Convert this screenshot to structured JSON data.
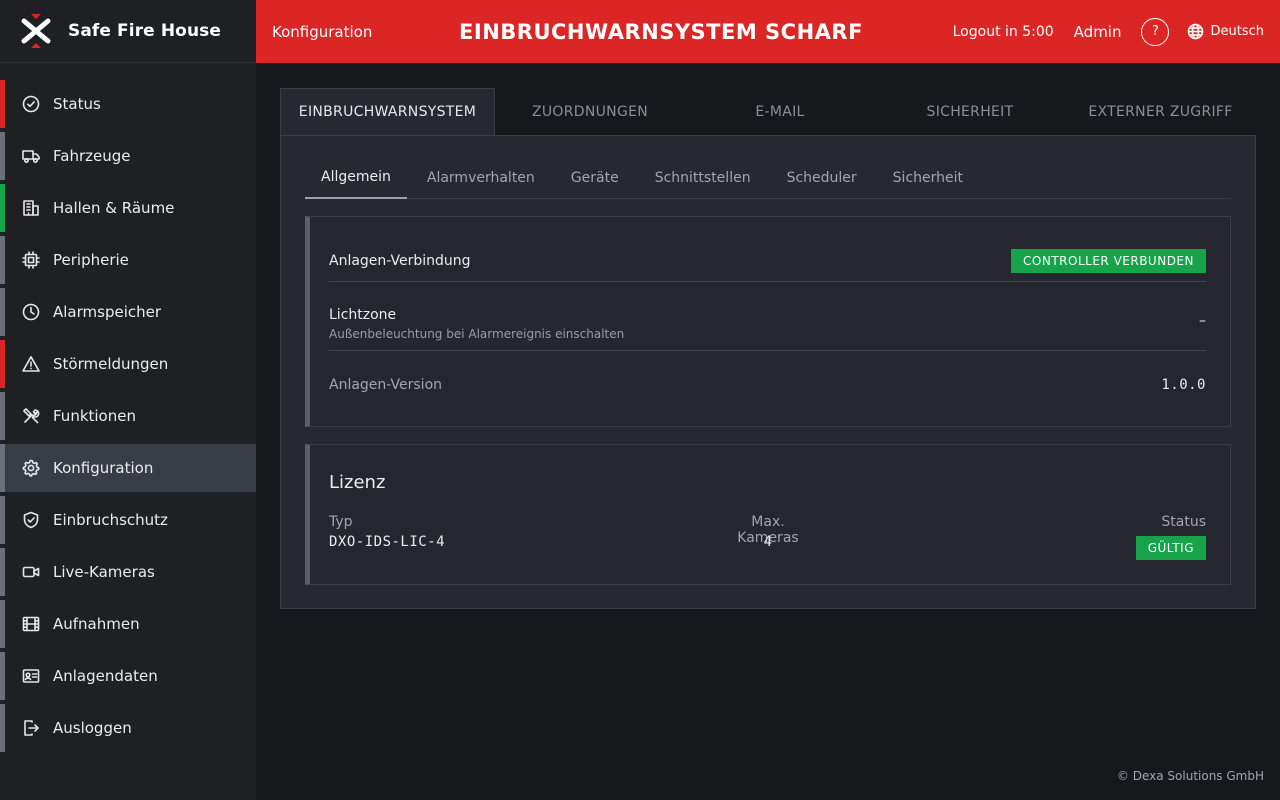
{
  "brand": {
    "name": "Safe Fire House"
  },
  "header": {
    "section": "Konfiguration",
    "title": "EINBRUCHWARNSYSTEM SCHARF",
    "logout": "Logout in 5:00",
    "user": "Admin",
    "help": "?",
    "language": "Deutsch"
  },
  "sidebar": {
    "items": [
      {
        "label": "Status",
        "icon": "check-circle-icon",
        "indicator": "#dc2626"
      },
      {
        "label": "Fahrzeuge",
        "icon": "truck-icon",
        "indicator": "#6b6f78"
      },
      {
        "label": "Hallen & Räume",
        "icon": "building-icon",
        "indicator": "#16a34a"
      },
      {
        "label": "Peripherie",
        "icon": "chip-icon",
        "indicator": "#6b6f78"
      },
      {
        "label": "Alarmspeicher",
        "icon": "clock-icon",
        "indicator": "#6b6f78"
      },
      {
        "label": "Störmeldungen",
        "icon": "warning-icon",
        "indicator": "#dc2626"
      },
      {
        "label": "Funktionen",
        "icon": "tools-icon",
        "indicator": "#6b6f78"
      },
      {
        "label": "Konfiguration",
        "icon": "gear-icon",
        "indicator": "#6b6f78",
        "active": true
      },
      {
        "label": "Einbruchschutz",
        "icon": "shield-icon",
        "indicator": "#6b6f78"
      },
      {
        "label": "Live-Kameras",
        "icon": "video-icon",
        "indicator": "#6b6f78"
      },
      {
        "label": "Aufnahmen",
        "icon": "film-icon",
        "indicator": "#6b6f78"
      },
      {
        "label": "Anlagendaten",
        "icon": "id-card-icon",
        "indicator": "#6b6f78"
      },
      {
        "label": "Ausloggen",
        "icon": "logout-icon",
        "indicator": "#6b6f78"
      }
    ]
  },
  "main_tabs": [
    {
      "label": "EINBRUCHWARNSYSTEM",
      "active": true
    },
    {
      "label": "ZUORDNUNGEN"
    },
    {
      "label": "E-MAIL"
    },
    {
      "label": "SICHERHEIT"
    },
    {
      "label": "EXTERNER ZUGRIFF"
    }
  ],
  "sub_tabs": [
    {
      "label": "Allgemein",
      "active": true
    },
    {
      "label": "Alarmverhalten"
    },
    {
      "label": "Geräte"
    },
    {
      "label": "Schnittstellen"
    },
    {
      "label": "Scheduler"
    },
    {
      "label": "Sicherheit"
    }
  ],
  "general": {
    "connection_label": "Anlagen-Verbindung",
    "connection_status": "CONTROLLER VERBUNDEN",
    "lightzone_label": "Lichtzone",
    "lightzone_desc": "Außenbeleuchtung bei Alarmereignis einschalten",
    "lightzone_value": "–",
    "version_label": "Anlagen-Version",
    "version_value": "1.0.0"
  },
  "license": {
    "title": "Lizenz",
    "type_label": "Typ",
    "type_value": "DXO-IDS-LIC-4",
    "cameras_label": "Max. Kameras",
    "cameras_value": "4",
    "status_label": "Status",
    "status_value": "GÜLTIG"
  },
  "footer": "© Dexa Solutions GmbH",
  "colors": {
    "accent_red": "#dc2626",
    "success_green": "#16a34a"
  }
}
